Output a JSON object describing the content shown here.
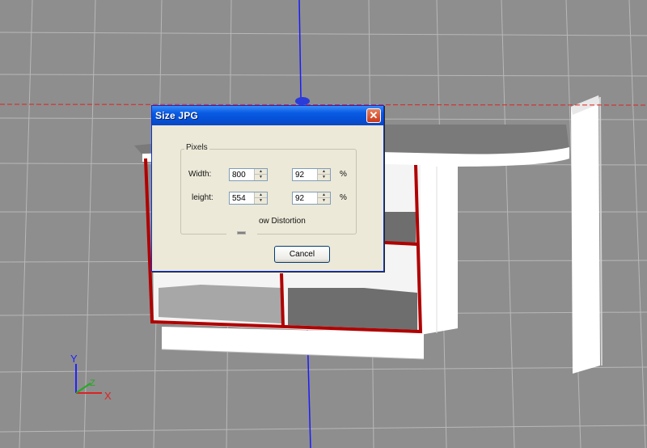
{
  "dialog": {
    "title": "Size JPG",
    "close_glyph": "✕",
    "group_label": "Pixels",
    "width_label": "Width:",
    "height_label": "leight:",
    "width_pixels": "800",
    "height_pixels": "554",
    "width_percent": "92",
    "height_percent": "92",
    "percent_symbol": "%",
    "distortion_label": "ow Distortion",
    "cancel_label": "Cancel"
  },
  "scene": {
    "axes": {
      "x": "X",
      "y": "Y",
      "z": "Z"
    },
    "colors": {
      "background": "#8e8e8e",
      "grid": "#b8b8b8",
      "cabinet_outline": "#b00000",
      "horizontal_guide": "#e02020",
      "vertical_guide": "#1a1aff"
    }
  }
}
